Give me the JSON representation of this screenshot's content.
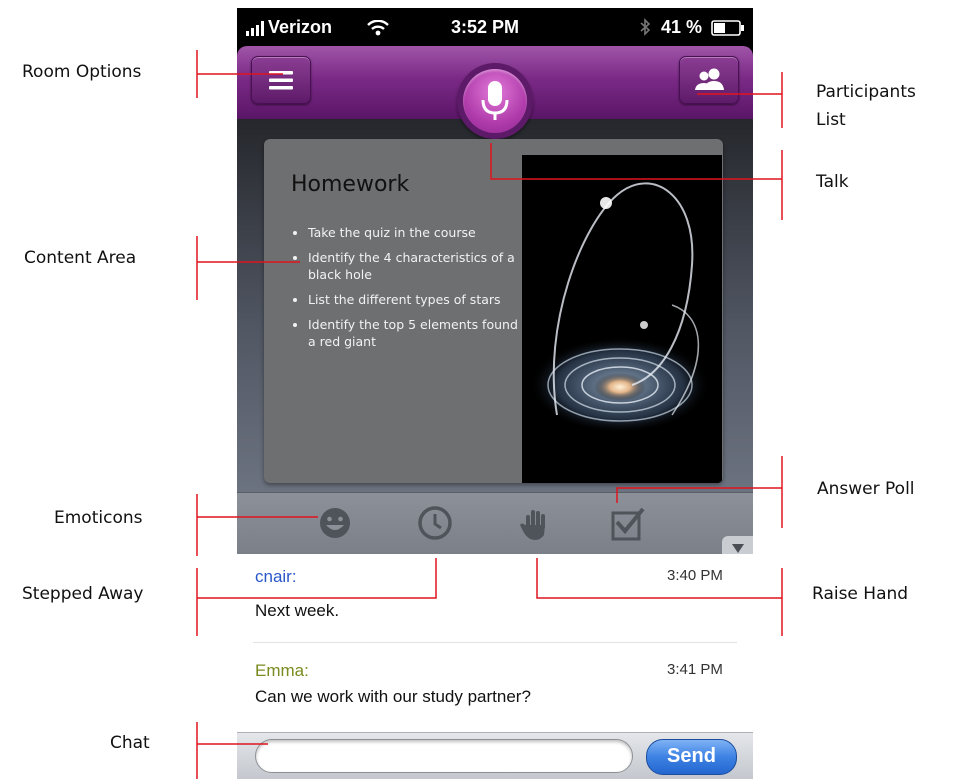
{
  "callouts": {
    "room_options": "Room Options",
    "participants_line1": "Participants",
    "participants_line2": "List",
    "talk": "Talk",
    "content_area": "Content Area",
    "emoticons": "Emoticons",
    "answer_poll": "Answer Poll",
    "stepped_away": "Stepped Away",
    "raise_hand": "Raise Hand",
    "chat": "Chat"
  },
  "status_bar": {
    "carrier": "Verizon",
    "time": "3:52 PM",
    "battery": "41 %"
  },
  "slide": {
    "title": "Homework",
    "bullets": [
      "Take the quiz in the course",
      "Identify the 4 characteristics of a black hole",
      "List the different types of stars",
      "Identify the top 5 elements found in a red giant"
    ]
  },
  "chat": {
    "messages": [
      {
        "name": "cnair:",
        "time": "3:40 PM",
        "text": "Next week.",
        "name_color": "#2a57c9"
      },
      {
        "name": "Emma:",
        "time": "3:41 PM",
        "text": "Can we work with our study partner?",
        "name_color": "#7a8a1e"
      }
    ],
    "input_value": "",
    "send_label": "Send"
  },
  "icons": {
    "room_options": "menu-icon",
    "talk": "microphone-icon",
    "participants": "participants-icon",
    "emoticons": "smiley-icon",
    "stepped_away": "clock-icon",
    "raise_hand": "hand-icon",
    "answer_poll": "checkbox-icon",
    "collapse": "triangle-down-icon"
  },
  "colors": {
    "accent_purple": "#7a2a86",
    "talk_pink": "#c04bb8",
    "send_blue": "#2f74dc",
    "leader_red": "#e0141e"
  }
}
